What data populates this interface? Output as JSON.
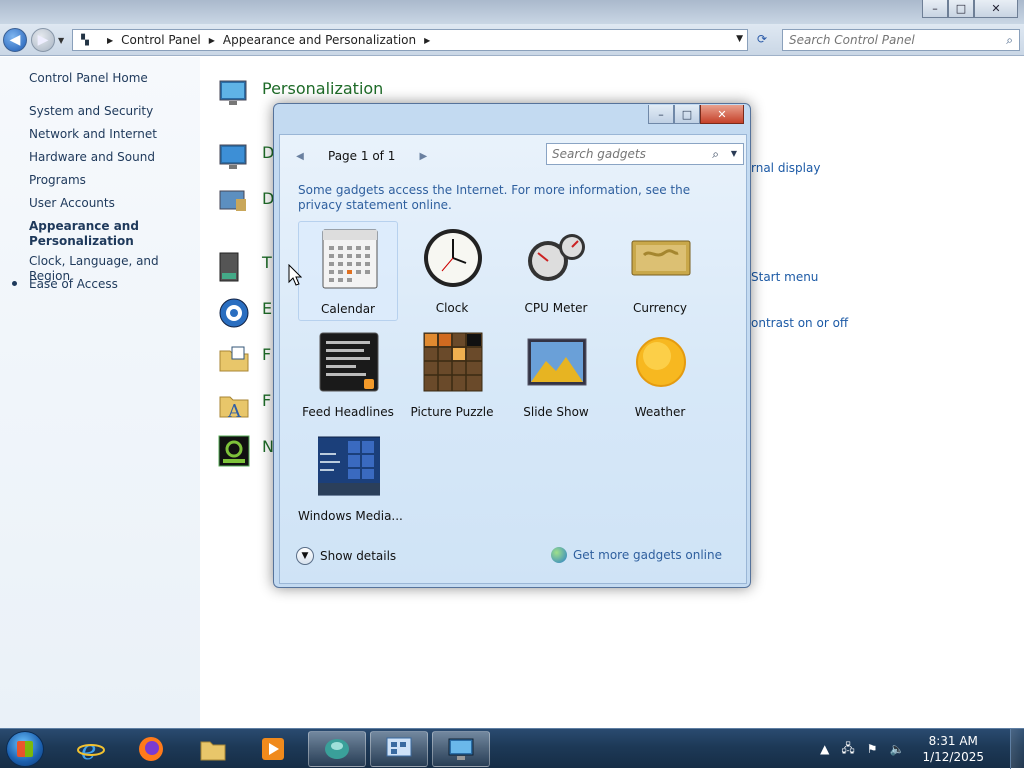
{
  "window": {
    "buttons": {
      "minimize": "–",
      "maximize": "□",
      "close": "✕"
    }
  },
  "address_bar": {
    "crumbs": [
      "Control Panel",
      "Appearance and Personalization"
    ],
    "search_placeholder": "Search Control Panel"
  },
  "sidebar": {
    "home": "Control Panel Home",
    "items": [
      {
        "label": "System and Security"
      },
      {
        "label": "Network and Internet"
      },
      {
        "label": "Hardware and Sound"
      },
      {
        "label": "Programs"
      },
      {
        "label": "User Accounts"
      },
      {
        "label": "Appearance and Personalization",
        "active": true
      },
      {
        "label": "Clock, Language, and Region"
      },
      {
        "label": "Ease of Access"
      }
    ]
  },
  "main": {
    "categories": [
      {
        "title": "Personalization",
        "icon": "personalization-icon"
      },
      {
        "title": "D",
        "icon": "display-icon"
      },
      {
        "title": "D",
        "icon": "desktop-gadgets-icon"
      },
      {
        "title": "T",
        "icon": "taskbar-icon"
      },
      {
        "title": "E",
        "icon": "ease-of-access-icon"
      },
      {
        "title": "F",
        "icon": "folder-options-icon"
      },
      {
        "title": "F",
        "icon": "fonts-icon"
      },
      {
        "title": "N",
        "icon": "nvidia-icon"
      }
    ],
    "visible_links": {
      "external_display": "rnal display",
      "start_menu": "Start menu",
      "contrast": "ontrast on or off"
    }
  },
  "gadget_window": {
    "pager": "Page 1 of 1",
    "search_placeholder": "Search gadgets",
    "notice": "Some gadgets access the Internet.  For more information, see the privacy statement online.",
    "gadgets": [
      {
        "name": "Calendar",
        "icon": "calendar-icon",
        "selected": true
      },
      {
        "name": "Clock",
        "icon": "clock-icon"
      },
      {
        "name": "CPU Meter",
        "icon": "cpu-meter-icon"
      },
      {
        "name": "Currency",
        "icon": "currency-icon"
      },
      {
        "name": "Feed Headlines",
        "icon": "feed-headlines-icon"
      },
      {
        "name": "Picture Puzzle",
        "icon": "picture-puzzle-icon"
      },
      {
        "name": "Slide Show",
        "icon": "slide-show-icon"
      },
      {
        "name": "Weather",
        "icon": "weather-icon"
      },
      {
        "name": "Windows Media...",
        "icon": "windows-media-icon"
      }
    ],
    "show_details": "Show details",
    "get_more": "Get more gadgets online"
  },
  "taskbar": {
    "apps": [
      {
        "name": "internet-explorer-icon"
      },
      {
        "name": "firefox-icon"
      },
      {
        "name": "file-explorer-icon"
      },
      {
        "name": "media-player-icon"
      },
      {
        "name": "gadget-app-icon",
        "open": true
      },
      {
        "name": "gadgets-window-icon",
        "open": true
      },
      {
        "name": "control-panel-icon",
        "open": true
      }
    ],
    "clock": {
      "time": "8:31 AM",
      "date": "1/12/2025"
    }
  },
  "colors": {
    "accent": "#1c5aa6",
    "category_title": "#1e6b28",
    "taskbar": "#1d3957"
  }
}
